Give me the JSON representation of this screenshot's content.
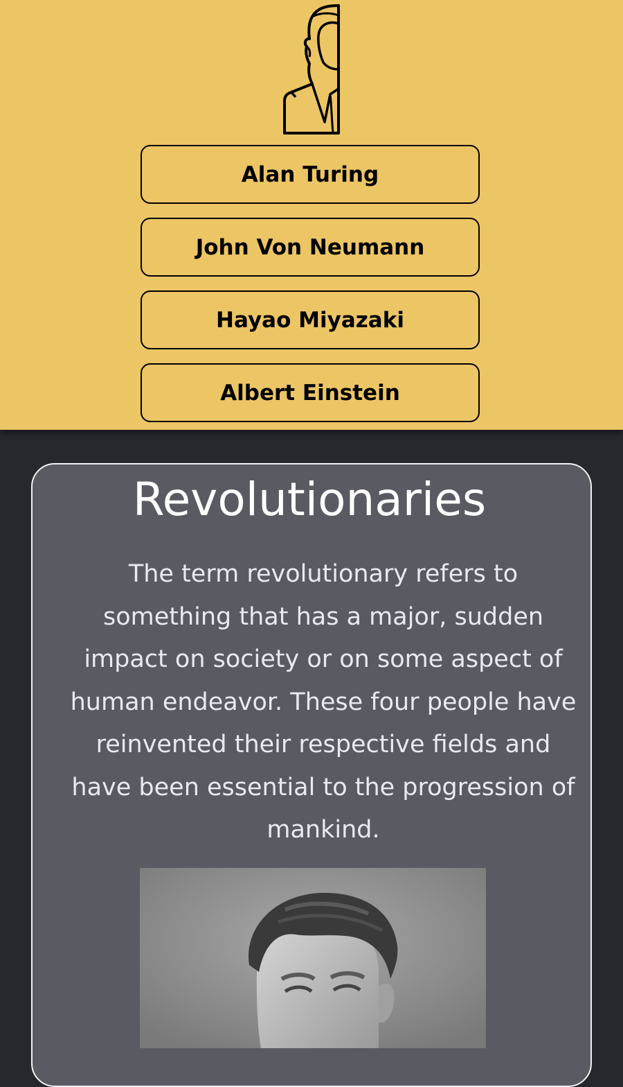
{
  "nav": {
    "logo_icon": "bust-silhouette-icon",
    "buttons": [
      {
        "label": "Alan Turing"
      },
      {
        "label": "John Von Neumann"
      },
      {
        "label": "Hayao Miyazaki"
      },
      {
        "label": "Albert Einstein"
      }
    ]
  },
  "main": {
    "title": "Revolutionaries",
    "description": "The term revolutionary refers to something that has a major, sudden impact on society or on some aspect of human endeavor. These four people have reinvented their respective fields and have been essential to the progression of mankind.",
    "portrait_icon": "portrait-photo-icon"
  },
  "colors": {
    "header_bg": "#ecc565",
    "page_bg": "#27282d",
    "card_bg": "#5a5b62",
    "card_border": "#f2f2f2"
  }
}
